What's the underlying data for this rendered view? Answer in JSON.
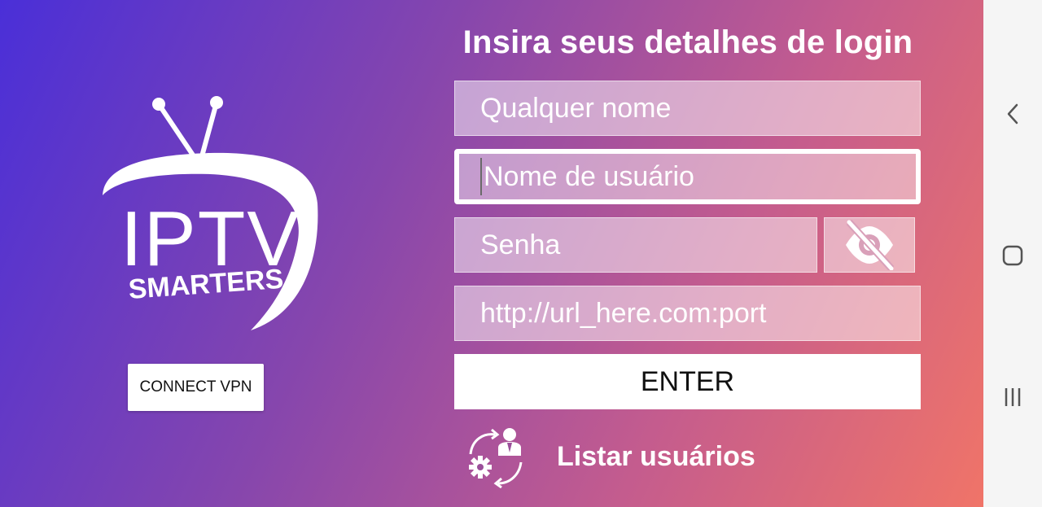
{
  "login": {
    "title": "Insira seus detalhes de login",
    "any_name_placeholder": "Qualquer nome",
    "username_placeholder": "Nome de usuário",
    "password_placeholder": "Senha",
    "url_placeholder": "http://url_here.com:port",
    "enter_label": "ENTER",
    "list_users_label": "Listar usuários"
  },
  "sidebar": {
    "connect_vpn_label": "CONNECT VPN",
    "logo_text_main": "IPTV",
    "logo_text_sub": "SMARTERS"
  },
  "icons": {
    "password_toggle": "eye-off-icon",
    "list_users": "users-manage-icon",
    "nav_back": "back-icon",
    "nav_home": "home-icon",
    "nav_recents": "recents-icon"
  },
  "colors": {
    "gradient_start": "#4a2fd8",
    "gradient_mid": "#8646ad",
    "gradient_end": "#f07468",
    "navbar_bg": "#f5f5f5"
  }
}
